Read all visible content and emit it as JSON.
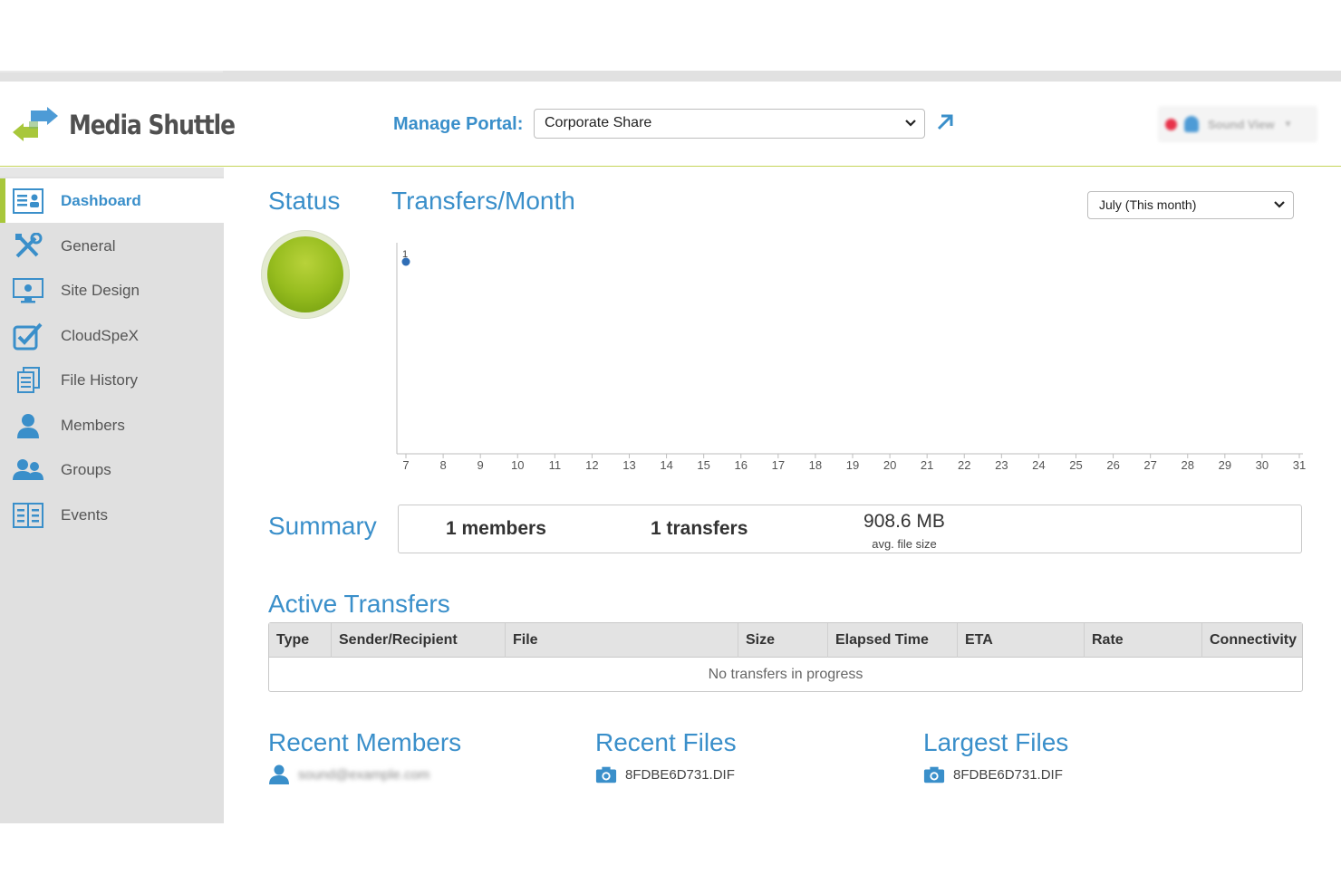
{
  "app": {
    "name": "Media Shuttle"
  },
  "header": {
    "manage_portal_label": "Manage Portal:",
    "portal_selected": "Corporate Share",
    "user_name": "Sound View"
  },
  "sidebar": {
    "items": [
      {
        "label": "Dashboard",
        "icon": "dashboard-icon",
        "active": true
      },
      {
        "label": "General",
        "icon": "tools-icon"
      },
      {
        "label": "Site Design",
        "icon": "site-design-icon"
      },
      {
        "label": "CloudSpeX",
        "icon": "checkbox-icon"
      },
      {
        "label": "File History",
        "icon": "file-history-icon"
      },
      {
        "label": "Members",
        "icon": "member-icon"
      },
      {
        "label": "Groups",
        "icon": "group-icon"
      },
      {
        "label": "Events",
        "icon": "events-icon"
      }
    ]
  },
  "status": {
    "title": "Status",
    "state": "ok",
    "color": "#97bd1f"
  },
  "transfers": {
    "title": "Transfers/Month",
    "month_selected": "July (This month)"
  },
  "chart_data": {
    "type": "scatter",
    "title": "Transfers/Month",
    "x": [
      7,
      8,
      9,
      10,
      11,
      12,
      13,
      14,
      15,
      16,
      17,
      18,
      19,
      20,
      21,
      22,
      23,
      24,
      25,
      26,
      27,
      28,
      29,
      30,
      31
    ],
    "points": [
      {
        "x": 7,
        "y": 1,
        "label": "1"
      }
    ],
    "xlim": [
      7,
      31
    ],
    "ylim": [
      0,
      1
    ],
    "grid": false,
    "color": "#2f6db5"
  },
  "summary": {
    "title": "Summary",
    "members": "1 members",
    "transfers": "1 transfers",
    "avg_size": "908.6 MB",
    "avg_size_label": "avg. file size"
  },
  "active_transfers": {
    "title": "Active Transfers",
    "columns": [
      "Type",
      "Sender/Recipient",
      "File",
      "Size",
      "Elapsed Time",
      "ETA",
      "Rate",
      "Connectivity"
    ],
    "empty_message": "No transfers in progress"
  },
  "recent_members": {
    "title": "Recent Members",
    "items": [
      "sound@example.com"
    ]
  },
  "recent_files": {
    "title": "Recent Files",
    "items": [
      "8FDBE6D731.DIF"
    ]
  },
  "largest_files": {
    "title": "Largest Files",
    "items": [
      "8FDBE6D731.DIF"
    ]
  },
  "colors": {
    "accent": "#3a8fca",
    "brand_green": "#a8c73b",
    "sidebar_bg": "#e0e0e0"
  }
}
